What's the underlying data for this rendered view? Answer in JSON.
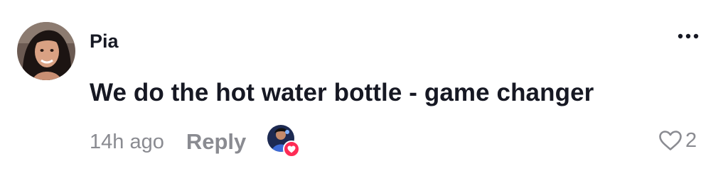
{
  "comment": {
    "username": "Pia",
    "text": "We do the hot water bottle - game changer",
    "timestamp": "14h ago",
    "reply_label": "Reply",
    "like_count": "2",
    "liked_by_creator": true
  },
  "icons": {
    "more": "more-horizontal-icon",
    "like": "heart-outline-icon",
    "creator_badge": "heart-filled-icon"
  },
  "colors": {
    "primary_text": "#161823",
    "secondary_text": "#8a8b91",
    "badge_red": "#fe2c55"
  }
}
